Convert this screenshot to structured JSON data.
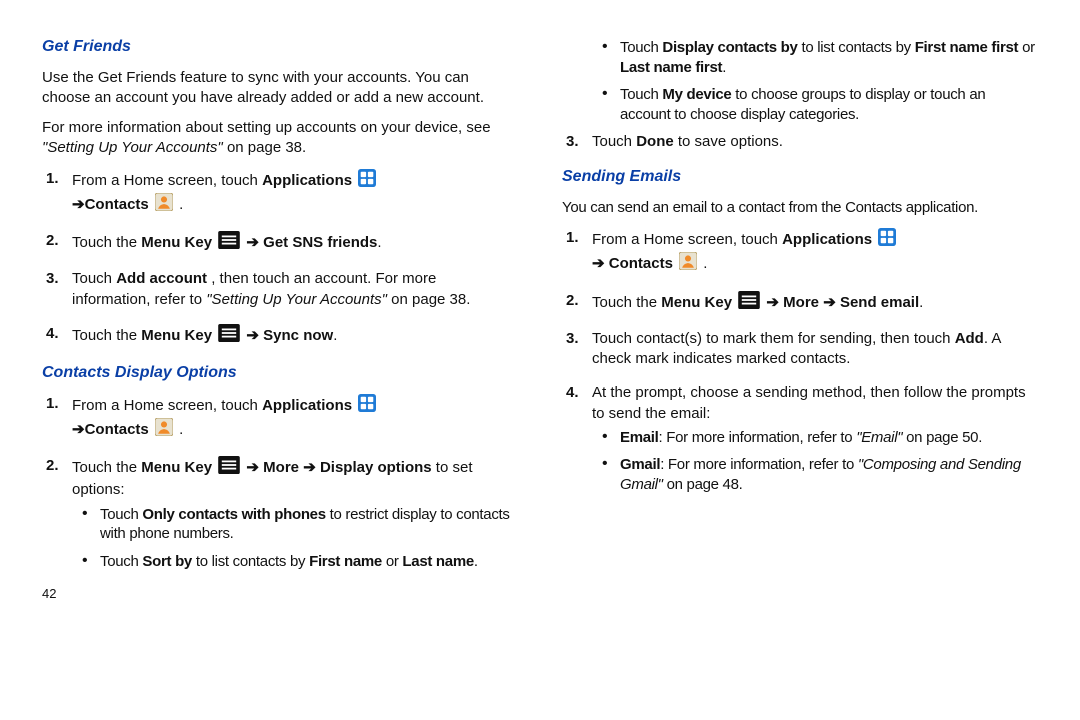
{
  "pageNumber": "42",
  "left": {
    "getFriends": {
      "heading": "Get Friends",
      "intro": "Use the Get Friends feature to sync with your accounts. You can choose an account you have already added or add a new account.",
      "moreInfo_a": "For more information about setting up accounts on your device, see ",
      "moreInfo_ref": "\"Setting Up Your Accounts\"",
      "moreInfo_b": " on page 38.",
      "step1_a": "From a Home screen, touch ",
      "step1_apps": "Applications",
      "step1_arrow": " ➔",
      "step1_contacts": "Contacts",
      "step1_end": " .",
      "step2_a": "Touch the ",
      "step2_menu": "Menu Key",
      "step2_arrow": " ➔ ",
      "step2_get": "Get SNS friends",
      "step2_end": ".",
      "step3_a": "Touch ",
      "step3_add": "Add account",
      "step3_b": ", then touch an account. For more information, refer to ",
      "step3_ref": "\"Setting Up Your Accounts\"",
      "step3_c": "  on page 38.",
      "step4_a": "Touch the ",
      "step4_menu": "Menu Key",
      "step4_arrow": " ➔ ",
      "step4_sync": "Sync now",
      "step4_end": "."
    },
    "displayOptions": {
      "heading": "Contacts Display Options",
      "step1_a": "From a Home screen, touch ",
      "step1_apps": "Applications",
      "step1_arrow": " ➔",
      "step1_contacts": "Contacts",
      "step1_end": " .",
      "step2_a": "Touch the ",
      "step2_menu": "Menu Key",
      "step2_arrow1": " ➔ ",
      "step2_more": "More",
      "step2_arrow2": " ➔ ",
      "step2_disp": "Display options",
      "step2_b": " to set options:",
      "b1_a": "Touch ",
      "b1_bold": "Only contacts with phones",
      "b1_b": " to restrict display to contacts with phone numbers.",
      "b2_a": "Touch ",
      "b2_sort": "Sort by",
      "b2_b": " to list contacts by ",
      "b2_fn": "First name",
      "b2_or": " or ",
      "b2_ln": "Last name",
      "b2_end": "."
    }
  },
  "right": {
    "bulletsTop": {
      "b1_a": "Touch ",
      "b1_disp": "Display contacts by",
      "b1_b": " to list contacts by ",
      "b1_fnf": "First name first",
      "b1_or": " or ",
      "b1_lnf": "Last name first",
      "b1_end": ".",
      "b2_a": "Touch ",
      "b2_myd": "My device",
      "b2_b": " to choose groups to display or touch an account to choose display categories."
    },
    "step3_a": "Touch ",
    "step3_done": "Done",
    "step3_b": " to save options.",
    "sendingEmails": {
      "heading": "Sending Emails",
      "intro": "You can send an email to a contact from the Contacts application.",
      "step1_a": "From a Home screen, touch ",
      "step1_apps": "Applications",
      "step1_arrow": " ➔ ",
      "step1_contacts": "Contacts",
      "step1_end": " .",
      "step2_a": "Touch the ",
      "step2_menu": "Menu Key",
      "step2_arrow1": " ➔ ",
      "step2_more": "More",
      "step2_arrow2": " ➔ ",
      "step2_send": "Send email",
      "step2_end": ".",
      "step3_a": "Touch contact(s) to mark them for sending, then touch ",
      "step3_add": "Add",
      "step3_b": ". A check mark indicates marked contacts.",
      "step4": "At the prompt, choose a sending method, then follow the prompts to send the email:",
      "b1_email": "Email",
      "b1_a": ": For more information, refer to ",
      "b1_ref": "\"Email\"",
      "b1_b": "  on page 50.",
      "b2_gmail": "Gmail",
      "b2_a": ": For more information, refer to ",
      "b2_ref": "\"Composing and Sending Gmail\"",
      "b2_b": "  on page 48."
    }
  }
}
